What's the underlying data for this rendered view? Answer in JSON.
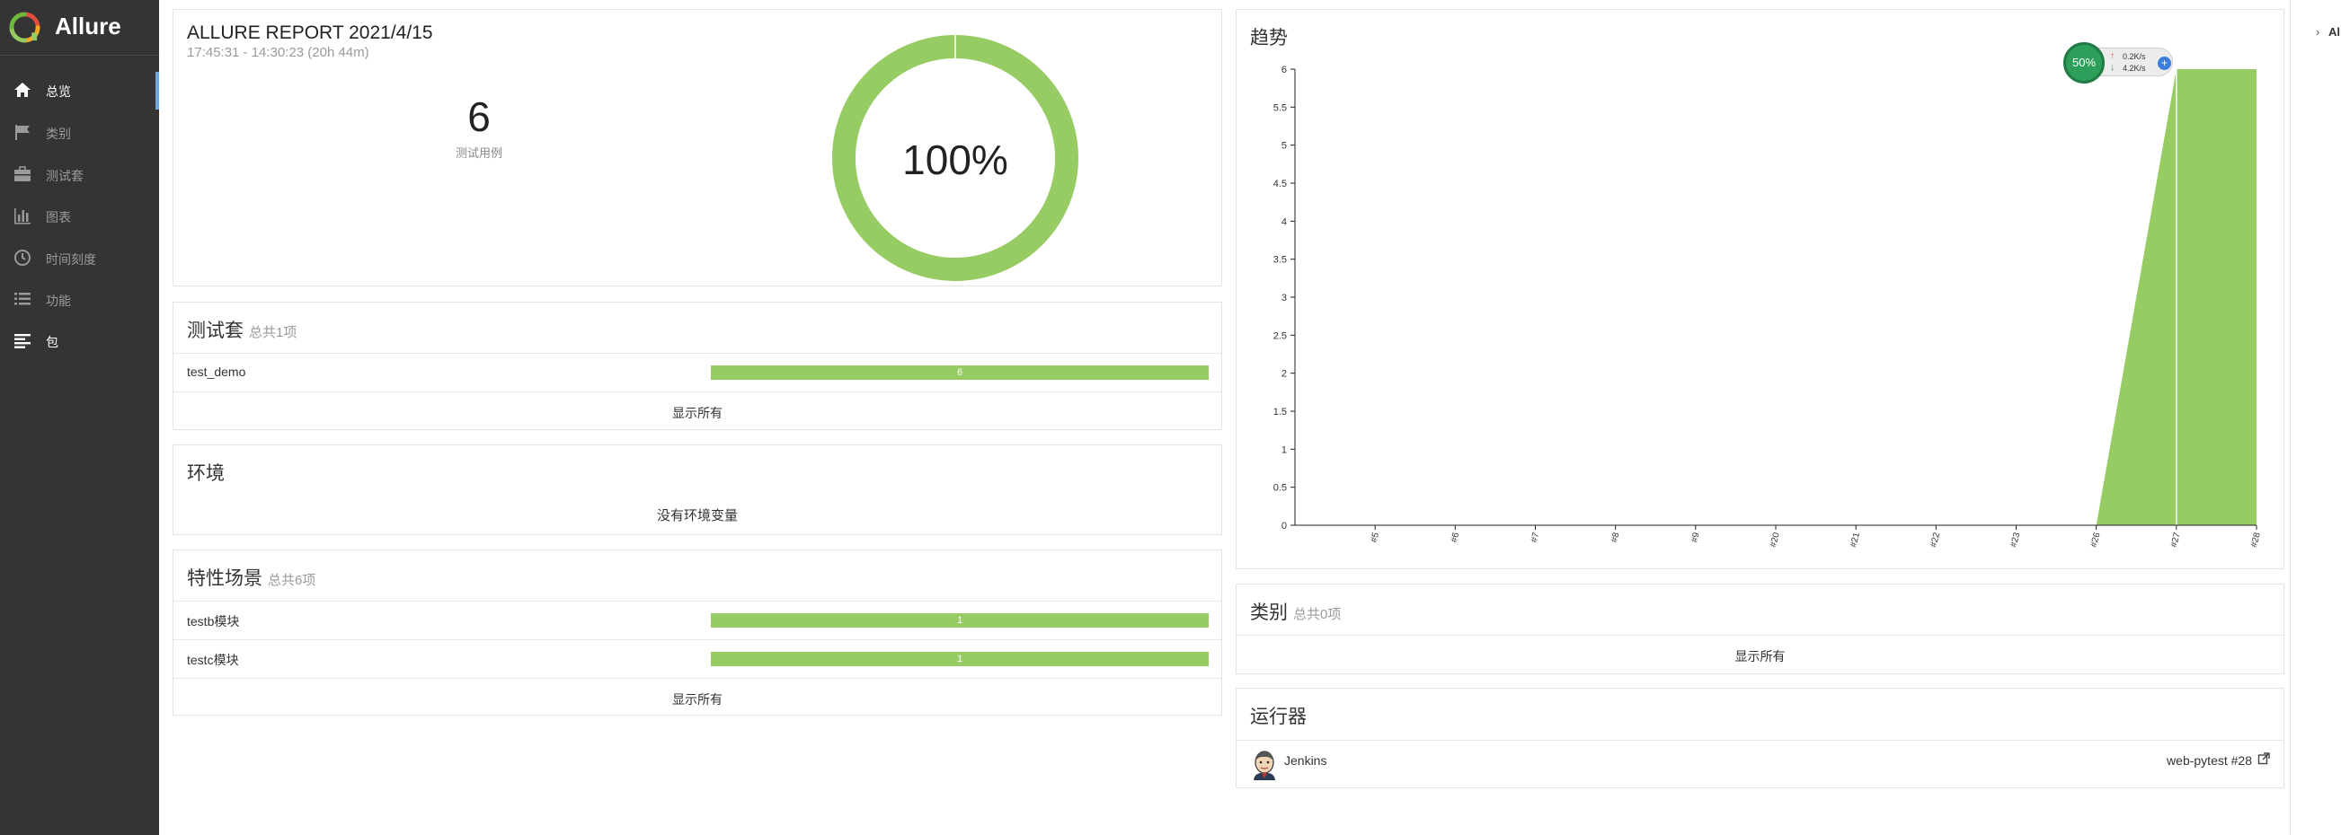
{
  "brand": {
    "title": "Allure"
  },
  "sidebar": {
    "items": [
      {
        "label": "总览",
        "icon": "home-icon",
        "active": true
      },
      {
        "label": "类别",
        "icon": "flag-icon"
      },
      {
        "label": "测试套",
        "icon": "briefcase-icon"
      },
      {
        "label": "图表",
        "icon": "bar-chart-icon"
      },
      {
        "label": "时间刻度",
        "icon": "clock-icon"
      },
      {
        "label": "功能",
        "icon": "list-icon"
      },
      {
        "label": "包",
        "icon": "align-left-icon"
      }
    ]
  },
  "summary": {
    "title": "ALLURE REPORT 2021/4/15",
    "time_range": "17:45:31 - 14:30:23 (20h 44m)",
    "test_count": "6",
    "test_count_label": "测试用例",
    "percent": "100%"
  },
  "suites": {
    "title": "测试套",
    "count_label": "总共1项",
    "rows": [
      {
        "name": "test_demo",
        "value": "6"
      }
    ],
    "show_all": "显示所有"
  },
  "environment": {
    "title": "环境",
    "empty_text": "没有环境变量"
  },
  "features": {
    "title": "特性场景",
    "count_label": "总共6项",
    "rows": [
      {
        "name": "testb模块",
        "value": "1"
      },
      {
        "name": "testc模块",
        "value": "1"
      }
    ],
    "show_all": "显示所有"
  },
  "trend": {
    "title": "趋势",
    "chart_data": {
      "type": "area",
      "x": [
        "#5",
        "#6",
        "#7",
        "#8",
        "#9",
        "#20",
        "#21",
        "#22",
        "#23",
        "#26",
        "#27",
        "#28"
      ],
      "values": [
        0,
        0,
        0,
        0,
        0,
        0,
        0,
        0,
        0,
        0,
        6,
        6
      ],
      "ylim": [
        0,
        6
      ],
      "yticks": [
        "0",
        "0.5",
        "1",
        "1.5",
        "2",
        "2.5",
        "3",
        "3.5",
        "4",
        "4.5",
        "5",
        "5.5",
        "6"
      ],
      "color": "#97cc64"
    }
  },
  "net_widget": {
    "percent": "50%",
    "up": "0.2K/s",
    "down": "4.2K/s"
  },
  "categories": {
    "title": "类别",
    "count_label": "总共0项",
    "show_all": "显示所有"
  },
  "executors": {
    "title": "运行器",
    "name": "Jenkins",
    "build": "web-pytest #28"
  },
  "right_pane": {
    "label": "Al"
  }
}
